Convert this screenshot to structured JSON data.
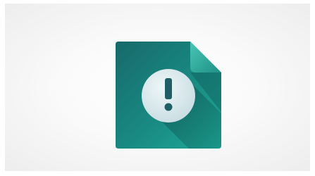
{
  "icon": {
    "name": "file-warning-icon",
    "symbol": "!",
    "colors": {
      "page_top": "#1e6f6f",
      "page_bottom": "#1aa394",
      "page_shadow": "#0f4f4f",
      "fold_light": "#3fbfae",
      "fold_dark": "#137a72",
      "circle_light": "#e6f1f3",
      "circle_dark": "#c9dde3",
      "glyph": "#1e5e64"
    }
  },
  "background": {
    "color_center": "#ffffff",
    "color_edge": "#ededed"
  }
}
